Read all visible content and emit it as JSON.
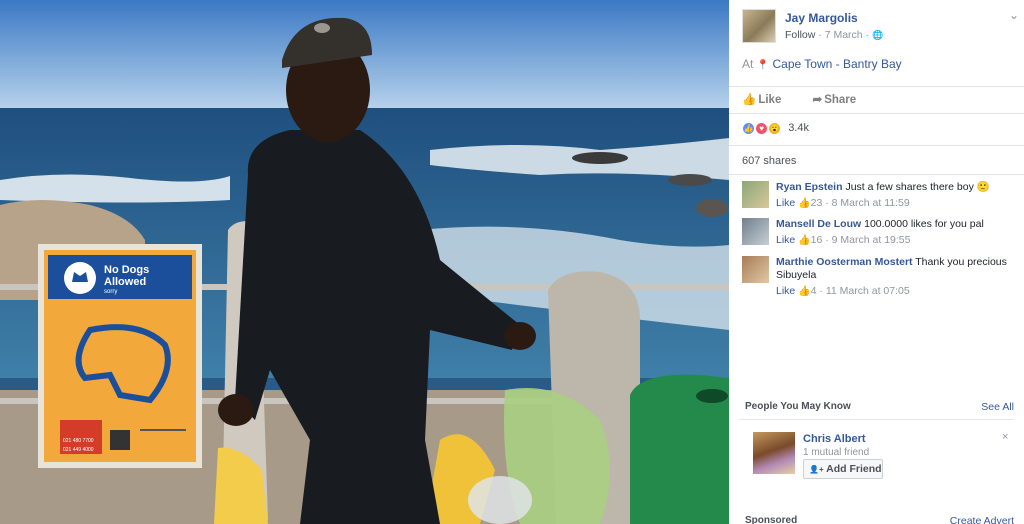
{
  "post": {
    "author": "Jay Margolis",
    "follow_label": "Follow",
    "dot": "·",
    "date": "7 March",
    "globe": "🌐",
    "menu_icon": "⌄",
    "at_label": "At",
    "location_icon": "📍",
    "location": "Cape Town - Bantry Bay",
    "like_label": "Like",
    "share_label": "Share",
    "like_icon": "👍",
    "share_icon": "➦",
    "reaction_count": "3.4k",
    "shares": "607 shares"
  },
  "sign": {
    "title": "No Dogs Allowed",
    "subtitle": "sorry",
    "phone1": "021 480 7700",
    "phone2": "021 449 4000"
  },
  "comments": [
    {
      "name": "Ryan Epstein",
      "text": "Just a few shares there boy 🙂",
      "like": "Like",
      "likes": "23",
      "time": "8 March at 11:59"
    },
    {
      "name": "Mansell De Louw",
      "text": "100.0000 likes for you pal",
      "like": "Like",
      "likes": "16",
      "time": "9 March at 19:55"
    },
    {
      "name": "Marthie Oosterman Mostert",
      "text": "Thank you precious Sibuyela",
      "like": "Like",
      "likes": "4",
      "time": "11 March at 07:05"
    }
  ],
  "pymk": {
    "title": "People You May Know",
    "see_all": "See All",
    "name": "Chris Albert",
    "mutual": "1 mutual friend",
    "add_friend": "Add Friend",
    "add_icon": "👤+",
    "close_icon": "×"
  },
  "footer": {
    "sponsored": "Sponsored",
    "create_advert": "Create Advert"
  },
  "colors": {
    "link": "#365899",
    "meta": "#90949c",
    "like_blue": "#5890ff",
    "love_red": "#f25268",
    "wow_yellow": "#f7b125"
  }
}
